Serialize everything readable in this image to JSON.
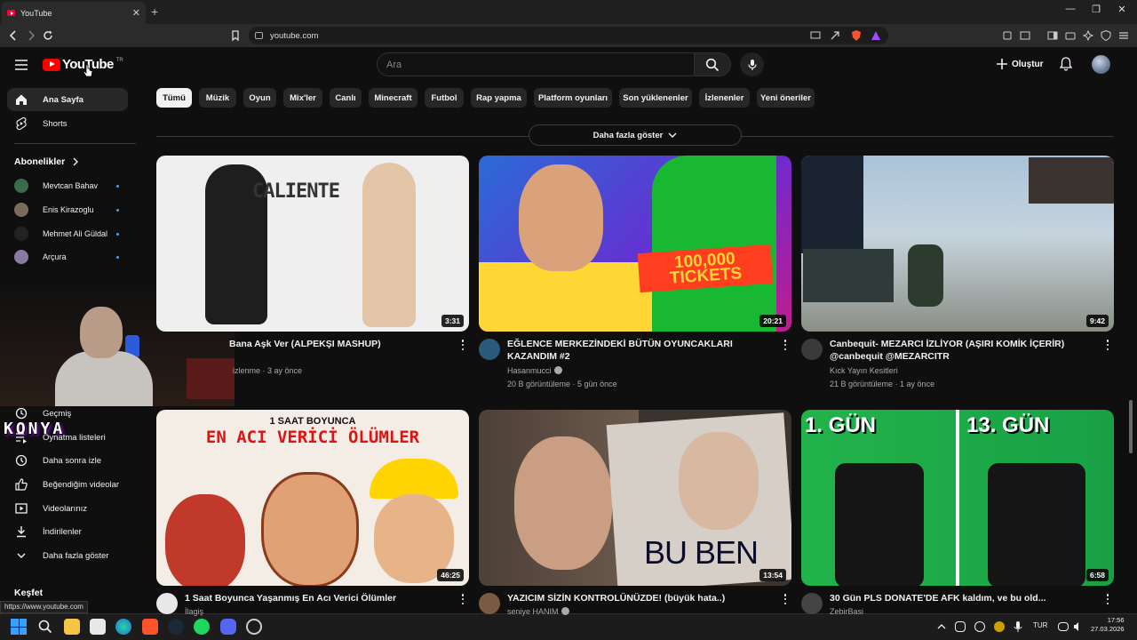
{
  "browser": {
    "tab_title": "YouTube",
    "url": "youtube.com",
    "status_url": "https://www.youtube.com"
  },
  "header": {
    "logo_text": "YouTube",
    "country_code": "TR",
    "search_placeholder": "Ara",
    "create_label": "Oluştur"
  },
  "sidebar": {
    "main": [
      {
        "label": "Ana Sayfa",
        "icon": "home-icon"
      },
      {
        "label": "Shorts",
        "icon": "shorts-icon"
      }
    ],
    "subscriptions_heading": "Abonelikler",
    "subscriptions": [
      {
        "label": "Mevtcan Bahav",
        "color": "#3a6b4a"
      },
      {
        "label": "Enis Kirazoglu",
        "color": "#7a6a5a"
      },
      {
        "label": "Mehmet Ali Güldal",
        "color": "#222222"
      },
      {
        "label": "Arçura",
        "color": "#8a7aa0"
      }
    ],
    "you_items": [
      {
        "label": "Geçmiş",
        "icon": "history-icon"
      },
      {
        "label": "Oynatma listeleri",
        "icon": "playlist-icon"
      },
      {
        "label": "Daha sonra izle",
        "icon": "watch-later-icon"
      },
      {
        "label": "Beğendiğim videolar",
        "icon": "like-icon"
      },
      {
        "label": "Videolarınız",
        "icon": "your-videos-icon"
      },
      {
        "label": "İndirilenler",
        "icon": "download-icon"
      },
      {
        "label": "Daha fazla göster",
        "icon": "chevron-down-icon"
      }
    ],
    "explore_heading": "Keşfet"
  },
  "overlay": {
    "streamer_logo": "KONYA"
  },
  "chips": [
    "Tümü",
    "Müzik",
    "Oyun",
    "Mix'ler",
    "Canlı",
    "Minecraft",
    "Futbol",
    "Rap yapma",
    "Platform oyunları",
    "Son yüklenenler",
    "İzlenenler",
    "Yeni öneriler"
  ],
  "show_more_label": "Daha fazla göster",
  "videos": [
    {
      "title": "Bana Aşk Ver (ALPEKŞI MASHUP)",
      "channel": "",
      "meta": "izlenme · 3 ay önce",
      "duration": "3:31",
      "thumb_text": "CALIENTE"
    },
    {
      "title": "EĞLENCE MERKEZİNDEKİ BÜTÜN OYUNCAKLARI KAZANDIM #2",
      "channel": "Hasanmucci",
      "meta": "20 B görüntüleme · 5 gün önce",
      "duration": "20:21",
      "thumb_text": "100,000 TICKETS"
    },
    {
      "title": "Canbequit- MEZARCI İZLİYOR (AŞIRI KOMİK İÇERİR) @canbequit @MEZARCITR",
      "channel": "Kıck Yayın Kesitleri",
      "meta": "21 B görüntüleme · 1 ay önce",
      "duration": "9:42",
      "thumb_text": ""
    },
    {
      "title": "1 Saat Boyunca Yaşanmış En Acı Verici Ölümler",
      "channel": "İlagiş",
      "meta": "",
      "duration": "46:25",
      "thumb_text": "EN ACI VERİCİ ÖLÜMLER"
    },
    {
      "title": "YAZICIM SİZİN KONTROLÜNÜZDE! (büyük hata..)",
      "channel": "seniye HANIM",
      "meta": "",
      "duration": "13:54",
      "thumb_text": "BU BEN"
    },
    {
      "title": "30 Gün PLS DONATE'DE AFK kaldım, ve bu old...",
      "channel": "ZebirBasi",
      "meta": "",
      "duration": "6:58",
      "thumb_text": "1. GÜN"
    }
  ],
  "thumb_captions": {
    "v0_sub": "1 SAAT BOYUNCA",
    "v5_b": "13. GÜN"
  },
  "taskbar": {
    "lang": "TUR",
    "time": "17:56",
    "date": "27.03.2026"
  }
}
